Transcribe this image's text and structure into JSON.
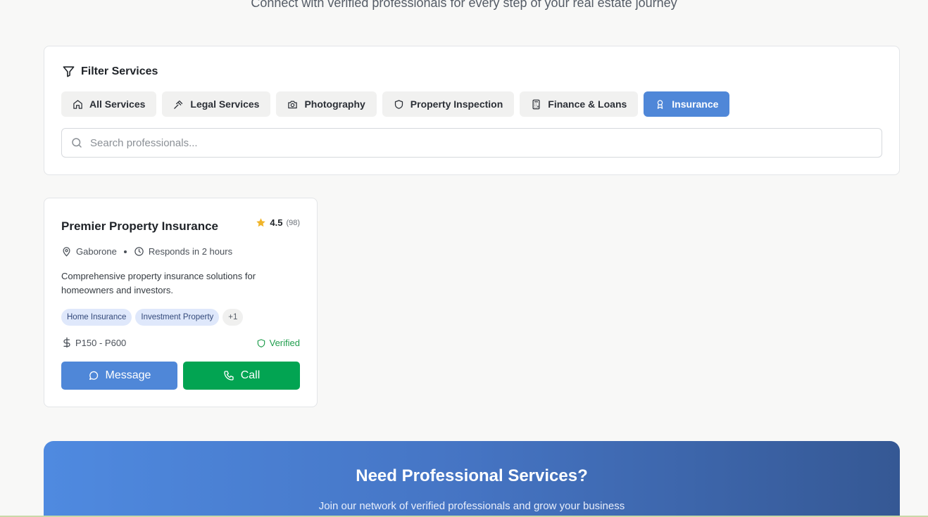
{
  "header": {
    "subtitle": "Connect with verified professionals for every step of your real estate journey"
  },
  "filters": {
    "title": "Filter Services",
    "chips": [
      {
        "label": "All Services",
        "icon": "home-icon"
      },
      {
        "label": "Legal Services",
        "icon": "gavel-icon"
      },
      {
        "label": "Photography",
        "icon": "camera-icon"
      },
      {
        "label": "Property Inspection",
        "icon": "shield-icon"
      },
      {
        "label": "Finance & Loans",
        "icon": "calculator-icon"
      },
      {
        "label": "Insurance",
        "icon": "award-icon"
      }
    ],
    "active_chip": "Insurance",
    "search_placeholder": "Search professionals...",
    "search_value": ""
  },
  "listing": {
    "name": "Premier Property Insurance",
    "rating": "4.5",
    "rating_count": "(98)",
    "location": "Gaborone",
    "response_time": "Responds in 2 hours",
    "description": "Comprehensive property insurance solutions for homeowners and investors.",
    "tags": [
      "Home Insurance",
      "Investment Property"
    ],
    "more_tags": "+1",
    "price_range": "P150 - P600",
    "verified_label": "Verified",
    "message_label": "Message",
    "call_label": "Call"
  },
  "cta": {
    "title": "Need Professional Services?",
    "subtitle": "Join our network of verified professionals and grow your business"
  },
  "colors": {
    "accent": "#4f87d8",
    "call": "#02a452",
    "verified": "#1f9d4c",
    "star": "#f0b429"
  }
}
